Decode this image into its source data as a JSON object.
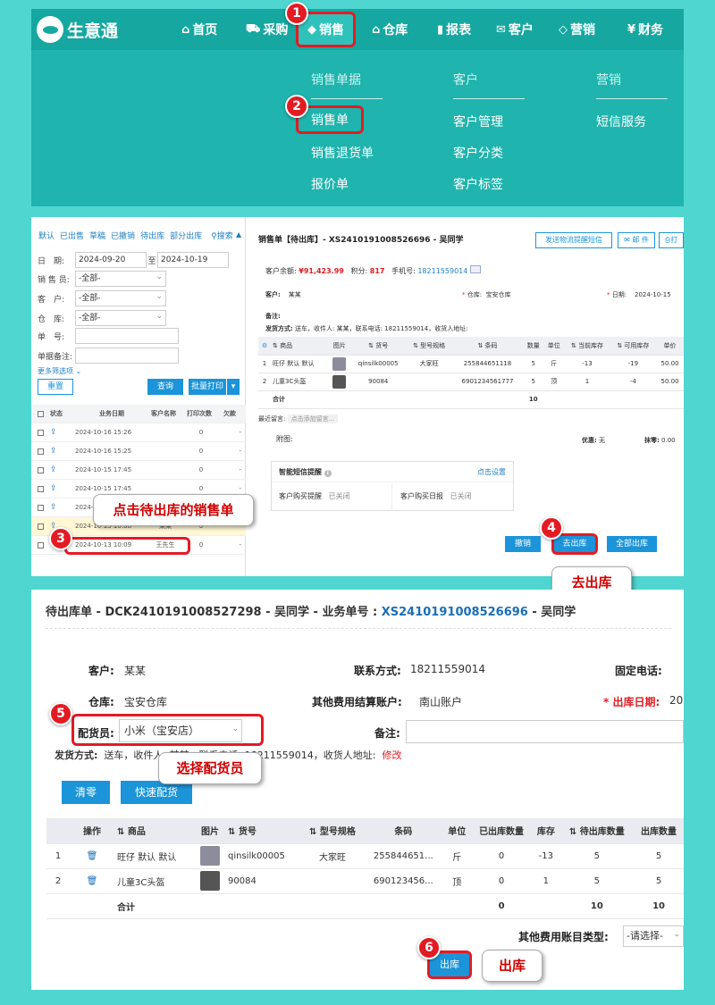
{
  "colors": {
    "brand": "#16a7a0",
    "accent": "#1b94d9",
    "highlight": "#e31b23",
    "callout_text": "#d00000"
  },
  "nav": {
    "logo_text": "生意通",
    "items": [
      {
        "label": "首页",
        "icon": "home-icon",
        "glyph": "⌂"
      },
      {
        "label": "采购",
        "icon": "cart-icon",
        "glyph": "🛒"
      },
      {
        "label": "销售",
        "icon": "tag-icon",
        "glyph": "🏷"
      },
      {
        "label": "仓库",
        "icon": "warehouse-icon",
        "glyph": "⌂"
      },
      {
        "label": "报表",
        "icon": "clipboard-icon",
        "glyph": "📋"
      },
      {
        "label": "客户",
        "icon": "mail-icon",
        "glyph": "✉"
      },
      {
        "label": "营销",
        "icon": "tag-outline-icon",
        "glyph": "🏷"
      },
      {
        "label": "财务",
        "icon": "yen-icon",
        "glyph": "¥"
      }
    ],
    "menu": {
      "col1": {
        "header": "销售单据",
        "items": [
          "销售单",
          "销售退货单",
          "报价单"
        ]
      },
      "col2": {
        "header": "客户",
        "items": [
          "客户管理",
          "客户分类",
          "客户标签"
        ]
      },
      "col3": {
        "header": "营销",
        "items": [
          "短信服务"
        ]
      }
    }
  },
  "steps": {
    "s1": "1",
    "s2": "2",
    "s3": "3",
    "s4": "4",
    "s5": "5",
    "s6": "6"
  },
  "callouts": {
    "c3": "点击待出库的销售单",
    "c4": "去出库",
    "c5": "选择配货员",
    "c6": "出库"
  },
  "list": {
    "tabs": [
      "默认",
      "已出售",
      "草稿",
      "已撤销",
      "待出库",
      "部分出库"
    ],
    "search": "搜索",
    "filters": {
      "date_label": "日　期:",
      "date_from": "2024-09-20",
      "to": "至",
      "date_to": "2024-10-19",
      "seller_label": "销 售 员:",
      "seller_val": "-全部-",
      "cust_label": "客　户:",
      "cust_val": "-全部-",
      "wh_label": "仓　库:",
      "wh_val": "-全部-",
      "no_label": "单　号:",
      "note_label": "单据备注:",
      "more": "更多筛选项"
    },
    "reset": "重置",
    "query": "查询",
    "batch_print": "批量打印",
    "columns": [
      "状态",
      "业务日期",
      "客户名称",
      "打印次数",
      "欠款"
    ],
    "rows": [
      {
        "date": "2024-10-16 15:26",
        "cust": "",
        "prints": "0",
        "debt": "-"
      },
      {
        "date": "2024-10-16 15:25",
        "cust": "",
        "prints": "0",
        "debt": "-"
      },
      {
        "date": "2024-10-15 17:45",
        "cust": "",
        "prints": "0",
        "debt": "-"
      },
      {
        "date": "2024-10-15 17:45",
        "cust": "",
        "prints": "0",
        "debt": "-"
      },
      {
        "date": "2024-",
        "cust": "",
        "prints": "0",
        "debt": "-"
      },
      {
        "date": "2024-10-15 10:08",
        "cust": "某某",
        "prints": "0",
        "debt": "-"
      },
      {
        "date": "2024-10-13 10:09",
        "cust": "王先生",
        "prints": "0",
        "debt": "-"
      }
    ]
  },
  "order": {
    "title": "销售单【待出库】- XS2410191008526696 - 吴同学",
    "sms_btn": "发送物流提醒短信",
    "mail_btn": "邮 件",
    "print_btn": "打",
    "balance_label": "客户余额:",
    "balance": "¥91,423.99",
    "points_label": "积分:",
    "points": "817",
    "phone_label": "手机号:",
    "phone": "18211559014",
    "cust_label": "客户:",
    "cust": "某某",
    "wh_label": "仓库:",
    "wh": "宝安仓库",
    "date_label": "日期:",
    "date": "2024-10-15",
    "note_label": "备注:",
    "ship_label": "发货方式:",
    "ship": "送车，收件人: 某某，联系电话: 18211559014，收货人地址:",
    "columns": [
      "商品",
      "图片",
      "货号",
      "型号规格",
      "条码",
      "数量",
      "单位",
      "当前库存",
      "可用库存",
      "单价"
    ],
    "rows": [
      {
        "no": "1",
        "name": "旺仔 默认 默认",
        "code": "qinsilk00005",
        "spec": "大家旺",
        "barcode": "255844651118",
        "qty": "5",
        "unit": "斤",
        "stock": "-13",
        "avail": "-19",
        "price": "50.00"
      },
      {
        "no": "2",
        "name": "儿童3C头盔",
        "code": "90084",
        "spec": "",
        "barcode": "6901234561777",
        "qty": "5",
        "unit": "顶",
        "stock": "1",
        "avail": "-4",
        "price": "50.00"
      }
    ],
    "total_label": "合计",
    "total_qty": "10",
    "msg_label": "最近留言:",
    "msg_placeholder": "点击添加留言...",
    "attach_label": "附图:",
    "discount_label": "优惠:",
    "discount": "无",
    "round_label": "抹零:",
    "round": "0.00",
    "sms_title": "智能短信提醒",
    "sms_setting": "点击设置",
    "sms_buy": "客户购买提醒",
    "sms_buy_state": "已关闭",
    "sms_daily": "客户购买日报",
    "sms_daily_state": "已关闭",
    "revoke": "撤销",
    "go_out": "去出库",
    "all_out": "全部出库"
  },
  "outbound": {
    "title_prefix": "待出库单 - DCK2410191008527298 - 吴同学 - 业务单号 : ",
    "title_link": "XS2410191008526696",
    "title_suffix": " - 吴同学",
    "cust_label": "客户:",
    "cust": "某某",
    "contact_label": "联系方式:",
    "contact": "18211559014",
    "phone_label": "固定电话:",
    "wh_label": "仓库:",
    "wh": "宝安仓库",
    "acct_label": "其他费用结算账户:",
    "acct": "南山账户",
    "date_label": "* 出库日期:",
    "date": "20",
    "picker_label": "配货员:",
    "picker": "小米（宝安店）",
    "note_label": "备注:",
    "ship_label": "发货方式:",
    "ship": "送车，收件人: 某某，联系电话: 18211559014，收货人地址:",
    "ship_edit": "修改",
    "clear": "清零",
    "quick": "快速配货",
    "columns": [
      "操作",
      "商品",
      "图片",
      "货号",
      "型号规格",
      "条码",
      "单位",
      "已出库数量",
      "库存",
      "待出库数量",
      "出库数量"
    ],
    "rows": [
      {
        "no": "1",
        "name": "旺仔 默认 默认",
        "code": "qinsilk00005",
        "spec": "大家旺",
        "barcode": "255844651...",
        "unit": "斤",
        "out": "0",
        "stock": "-13",
        "pending": "5",
        "qty": "5"
      },
      {
        "no": "2",
        "name": "儿童3C头盔",
        "code": "90084",
        "spec": "",
        "barcode": "690123456...",
        "unit": "顶",
        "out": "0",
        "stock": "1",
        "pending": "5",
        "qty": "5"
      }
    ],
    "total_label": "合计",
    "total_out": "0",
    "total_pending": "10",
    "total_qty": "10",
    "fee_label": "其他费用账目类型:",
    "fee_placeholder": "-请选择-",
    "out_btn": "出库"
  }
}
